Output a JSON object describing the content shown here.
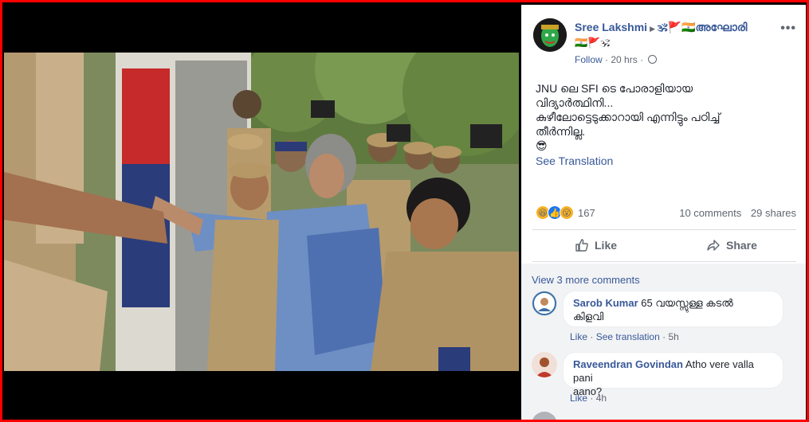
{
  "colors": {
    "frame": "#ff0000",
    "link": "#385898",
    "muted": "#606770",
    "text": "#1d2129",
    "comments_bg": "#f2f3f5"
  },
  "post": {
    "author": "Sree Lakshmi",
    "group_name": "🕉🚩🇮🇳അഘോരി",
    "group_suffix_emojis": "🇮🇳🚩🕉",
    "follow_label": "Follow",
    "time": "20 hrs",
    "privacy_icon": "globe-icon",
    "more_icon": "more-options-icon",
    "text_lines": [
      "JNU ലെ SFI ടെ പോരാളിയായ",
      "വിദ്യാർത്ഥിനി...",
      "കുഴീലോട്ടെടുക്കാറായി എന്നിട്ടും പഠിച്ച്",
      "തീർന്നില്ല.",
      "😎"
    ],
    "see_translation": "See Translation",
    "reaction_icons": [
      "😆",
      "👍",
      "😮"
    ],
    "reaction_count": "167",
    "comments_count": "10 comments",
    "shares_count": "29 shares",
    "like_label": "Like",
    "share_label": "Share"
  },
  "comments": {
    "view_more": "View 3 more comments",
    "items": [
      {
        "name": "Sarob Kumar",
        "text_line1": "65 വയസ്സുള്ള കടൽ",
        "text_line2": "കിളവി",
        "like": "Like",
        "translation": "See translation",
        "time": "5h"
      },
      {
        "name": "Raveendran Govindan",
        "text_line1": "Atho vere valla pani",
        "text_line2": "aano?",
        "like": "Like",
        "time": "4h"
      }
    ]
  }
}
